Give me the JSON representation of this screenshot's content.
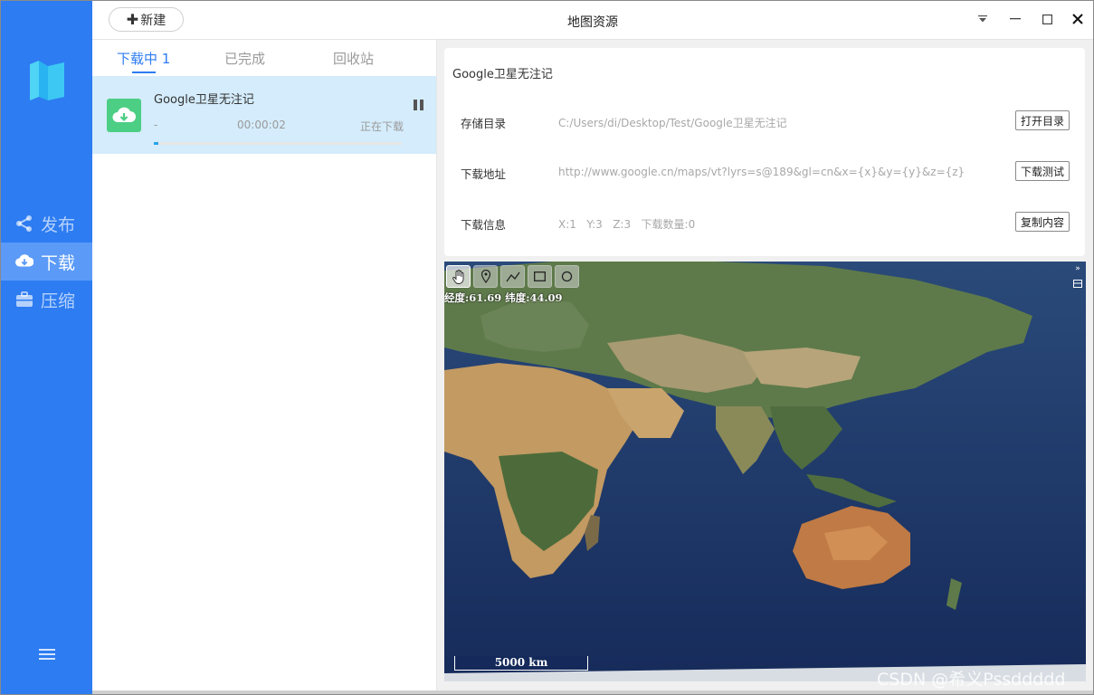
{
  "window": {
    "title": "地图资源"
  },
  "toolbar": {
    "new_label": "新建",
    "new_icon": "plus-icon"
  },
  "sidebar": {
    "accent": "#2d7cf2",
    "items": [
      {
        "label": "发布",
        "icon": "share-icon",
        "active": false
      },
      {
        "label": "下载",
        "icon": "cloud-download-icon",
        "active": true
      },
      {
        "label": "压缩",
        "icon": "briefcase-icon",
        "active": false
      }
    ]
  },
  "tabs": [
    {
      "label": "下载中 1",
      "active": true
    },
    {
      "label": "已完成",
      "active": false
    },
    {
      "label": "回收站",
      "active": false
    }
  ],
  "task": {
    "name": "Google卫星无注记",
    "speed": "-",
    "elapsed": "00:00:02",
    "status": "正在下载",
    "progress": 0.02
  },
  "details": {
    "title": "Google卫星无注记",
    "rows": [
      {
        "label": "存储目录",
        "value": "C:/Users/di/Desktop/Test/Google卫星无注记",
        "button": "打开目录"
      },
      {
        "label": "下载地址",
        "value": "http://www.google.cn/maps/vt?lyrs=s@189&gl=cn&x={x}&y={y}&z={z}",
        "button": "下载测试"
      },
      {
        "label": "下载信息",
        "value": "X:1   Y:3   Z:3   下载数量:0",
        "button": "复制内容"
      }
    ]
  },
  "map": {
    "coords": "经度:61.69 纬度:44.09",
    "scale": "5000 km",
    "tools": [
      "hand-icon",
      "marker-icon",
      "polyline-icon",
      "rectangle-icon",
      "circle-icon"
    ]
  },
  "watermark": "CSDN @希义Pssddddd"
}
